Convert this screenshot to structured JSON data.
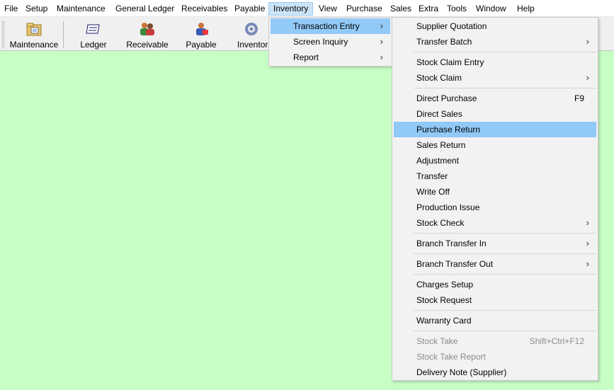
{
  "menubar": {
    "items": [
      "File",
      "Setup",
      "Maintenance",
      "General Ledger",
      "Receivables",
      "Payable",
      "Inventory",
      "View",
      "Purchase",
      "Sales",
      "Extra",
      "Tools",
      "Window",
      "Help"
    ],
    "open_item": "Inventory"
  },
  "toolbar": {
    "buttons": [
      {
        "label": "Maintenance",
        "icon": "maintenance-icon"
      },
      {
        "label": "Ledger",
        "icon": "ledger-icon"
      },
      {
        "label": "Receivable",
        "icon": "receivable-icon"
      },
      {
        "label": "Payable",
        "icon": "payable-icon"
      },
      {
        "label": "Inventor",
        "icon": "inventory-gear-icon"
      }
    ]
  },
  "inventory_menu": {
    "items": [
      {
        "label": "Transaction Entry",
        "submenu": true,
        "highlighted": true
      },
      {
        "label": "Screen Inquiry",
        "submenu": true
      },
      {
        "label": "Report",
        "submenu": true
      }
    ]
  },
  "transaction_entry_menu": {
    "items": [
      {
        "label": "Supplier Quotation"
      },
      {
        "label": "Transfer Batch",
        "submenu": true
      },
      {
        "label": "Stock Claim Entry"
      },
      {
        "label": "Stock Claim",
        "submenu": true
      },
      {
        "label": "Direct Purchase",
        "shortcut": "F9"
      },
      {
        "label": "Direct Sales"
      },
      {
        "label": "Purchase Return",
        "highlighted": true
      },
      {
        "label": "Sales Return"
      },
      {
        "label": "Adjustment"
      },
      {
        "label": "Transfer"
      },
      {
        "label": "Write Off"
      },
      {
        "label": "Production Issue"
      },
      {
        "label": "Stock Check",
        "submenu": true
      },
      {
        "label": "Branch Transfer In",
        "submenu": true
      },
      {
        "label": "Branch Transfer Out",
        "submenu": true
      },
      {
        "label": "Charges Setup"
      },
      {
        "label": "Stock Request"
      },
      {
        "label": "Warranty Card"
      },
      {
        "label": "Stock Take",
        "shortcut": "Shift+Ctrl+F12",
        "disabled": true
      },
      {
        "label": "Stock Take Report",
        "disabled": true
      },
      {
        "label": "Delivery Note (Supplier)"
      }
    ]
  },
  "colors": {
    "workspace": "#c6fec6",
    "highlight": "#91c9f7",
    "menu_bg": "#f2f2f2",
    "open_menubar_item": "#cce4f7"
  }
}
